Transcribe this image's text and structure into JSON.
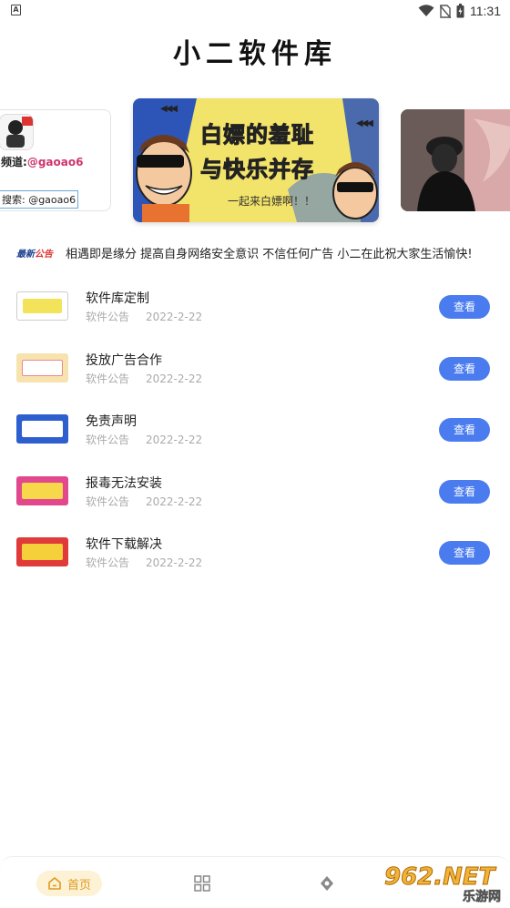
{
  "status_bar": {
    "app_icon_letter": "A",
    "time": "11:31",
    "icons": [
      "wifi-icon",
      "no-sim-icon",
      "battery-charging-icon"
    ]
  },
  "header": {
    "title": "小二软件库"
  },
  "banners": {
    "left": {
      "line1_prefix": "频道:",
      "line1_handle": "@gaoao6",
      "line2": "搜索: @gaoao6"
    },
    "main": {
      "title_line1_a": "白嫖的",
      "title_line1_b": "羞耻",
      "title_line2_a": "与",
      "title_line2_b": "快乐",
      "title_line2_c": "并存",
      "subtitle": "一起来白嫖啊！！",
      "arrows": "◀◀◀"
    }
  },
  "notice": {
    "tag_a": "最新",
    "tag_b": "公告",
    "text": "相遇即是缘分 提高自身网络安全意识 不信任何广告 小二在此祝大家生活愉快!"
  },
  "list": [
    {
      "title": "软件库定制",
      "category": "软件公告",
      "date": "2022-2-22",
      "button": "查看"
    },
    {
      "title": "投放广告合作",
      "category": "软件公告",
      "date": "2022-2-22",
      "button": "查看"
    },
    {
      "title": "免责声明",
      "category": "软件公告",
      "date": "2022-2-22",
      "button": "查看"
    },
    {
      "title": "报毒无法安装",
      "category": "软件公告",
      "date": "2022-2-22",
      "button": "查看"
    },
    {
      "title": "软件下载解决",
      "category": "软件公告",
      "date": "2022-2-22",
      "button": "查看"
    }
  ],
  "bottom_nav": {
    "home_label": "首页",
    "items": [
      "home-icon",
      "grid-icon",
      "discover-icon"
    ]
  },
  "watermark": {
    "big": "962.NET",
    "small": "乐游网"
  },
  "colors": {
    "accent_button": "#4a7cf0",
    "nav_active_bg": "#fdf2d6",
    "nav_active_text": "#e09a1e"
  }
}
